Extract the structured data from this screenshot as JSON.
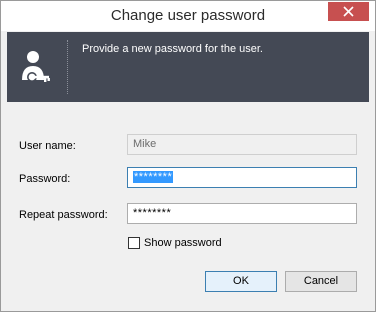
{
  "window": {
    "title": "Change user password"
  },
  "header": {
    "description": "Provide a new password for the user.",
    "icon": "user-key-icon"
  },
  "form": {
    "username_label": "User name:",
    "username_value": "Mike",
    "password_label": "Password:",
    "password_value": "********",
    "repeat_label": "Repeat password:",
    "repeat_value": "********",
    "show_password_label": "Show password",
    "show_password_checked": false
  },
  "buttons": {
    "ok_label": "OK",
    "cancel_label": "Cancel"
  },
  "colors": {
    "header_bg": "#444955",
    "close_button": "#c75050",
    "selection": "#3399ff"
  }
}
